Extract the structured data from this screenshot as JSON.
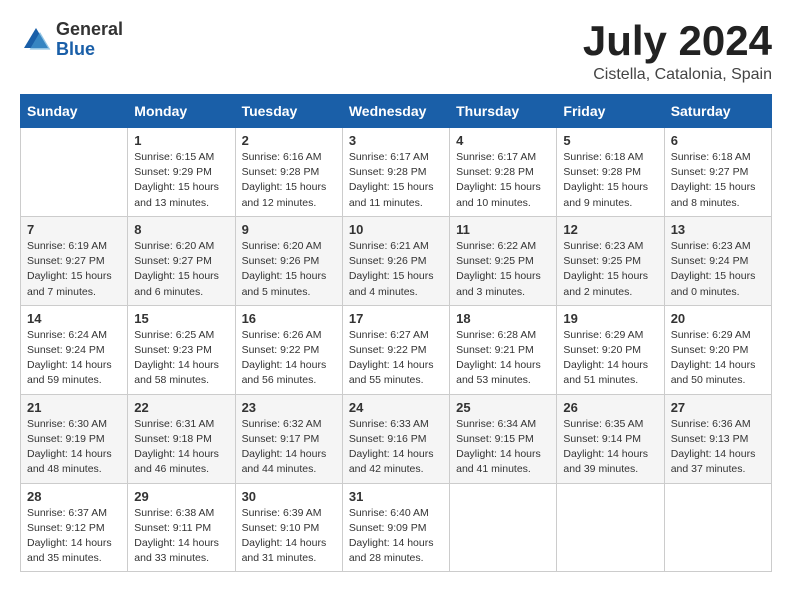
{
  "logo": {
    "general": "General",
    "blue": "Blue"
  },
  "header": {
    "month_year": "July 2024",
    "location": "Cistella, Catalonia, Spain"
  },
  "weekdays": [
    "Sunday",
    "Monday",
    "Tuesday",
    "Wednesday",
    "Thursday",
    "Friday",
    "Saturday"
  ],
  "weeks": [
    [
      {
        "day": "",
        "info": ""
      },
      {
        "day": "1",
        "info": "Sunrise: 6:15 AM\nSunset: 9:29 PM\nDaylight: 15 hours\nand 13 minutes."
      },
      {
        "day": "2",
        "info": "Sunrise: 6:16 AM\nSunset: 9:28 PM\nDaylight: 15 hours\nand 12 minutes."
      },
      {
        "day": "3",
        "info": "Sunrise: 6:17 AM\nSunset: 9:28 PM\nDaylight: 15 hours\nand 11 minutes."
      },
      {
        "day": "4",
        "info": "Sunrise: 6:17 AM\nSunset: 9:28 PM\nDaylight: 15 hours\nand 10 minutes."
      },
      {
        "day": "5",
        "info": "Sunrise: 6:18 AM\nSunset: 9:28 PM\nDaylight: 15 hours\nand 9 minutes."
      },
      {
        "day": "6",
        "info": "Sunrise: 6:18 AM\nSunset: 9:27 PM\nDaylight: 15 hours\nand 8 minutes."
      }
    ],
    [
      {
        "day": "7",
        "info": "Sunrise: 6:19 AM\nSunset: 9:27 PM\nDaylight: 15 hours\nand 7 minutes."
      },
      {
        "day": "8",
        "info": "Sunrise: 6:20 AM\nSunset: 9:27 PM\nDaylight: 15 hours\nand 6 minutes."
      },
      {
        "day": "9",
        "info": "Sunrise: 6:20 AM\nSunset: 9:26 PM\nDaylight: 15 hours\nand 5 minutes."
      },
      {
        "day": "10",
        "info": "Sunrise: 6:21 AM\nSunset: 9:26 PM\nDaylight: 15 hours\nand 4 minutes."
      },
      {
        "day": "11",
        "info": "Sunrise: 6:22 AM\nSunset: 9:25 PM\nDaylight: 15 hours\nand 3 minutes."
      },
      {
        "day": "12",
        "info": "Sunrise: 6:23 AM\nSunset: 9:25 PM\nDaylight: 15 hours\nand 2 minutes."
      },
      {
        "day": "13",
        "info": "Sunrise: 6:23 AM\nSunset: 9:24 PM\nDaylight: 15 hours\nand 0 minutes."
      }
    ],
    [
      {
        "day": "14",
        "info": "Sunrise: 6:24 AM\nSunset: 9:24 PM\nDaylight: 14 hours\nand 59 minutes."
      },
      {
        "day": "15",
        "info": "Sunrise: 6:25 AM\nSunset: 9:23 PM\nDaylight: 14 hours\nand 58 minutes."
      },
      {
        "day": "16",
        "info": "Sunrise: 6:26 AM\nSunset: 9:22 PM\nDaylight: 14 hours\nand 56 minutes."
      },
      {
        "day": "17",
        "info": "Sunrise: 6:27 AM\nSunset: 9:22 PM\nDaylight: 14 hours\nand 55 minutes."
      },
      {
        "day": "18",
        "info": "Sunrise: 6:28 AM\nSunset: 9:21 PM\nDaylight: 14 hours\nand 53 minutes."
      },
      {
        "day": "19",
        "info": "Sunrise: 6:29 AM\nSunset: 9:20 PM\nDaylight: 14 hours\nand 51 minutes."
      },
      {
        "day": "20",
        "info": "Sunrise: 6:29 AM\nSunset: 9:20 PM\nDaylight: 14 hours\nand 50 minutes."
      }
    ],
    [
      {
        "day": "21",
        "info": "Sunrise: 6:30 AM\nSunset: 9:19 PM\nDaylight: 14 hours\nand 48 minutes."
      },
      {
        "day": "22",
        "info": "Sunrise: 6:31 AM\nSunset: 9:18 PM\nDaylight: 14 hours\nand 46 minutes."
      },
      {
        "day": "23",
        "info": "Sunrise: 6:32 AM\nSunset: 9:17 PM\nDaylight: 14 hours\nand 44 minutes."
      },
      {
        "day": "24",
        "info": "Sunrise: 6:33 AM\nSunset: 9:16 PM\nDaylight: 14 hours\nand 42 minutes."
      },
      {
        "day": "25",
        "info": "Sunrise: 6:34 AM\nSunset: 9:15 PM\nDaylight: 14 hours\nand 41 minutes."
      },
      {
        "day": "26",
        "info": "Sunrise: 6:35 AM\nSunset: 9:14 PM\nDaylight: 14 hours\nand 39 minutes."
      },
      {
        "day": "27",
        "info": "Sunrise: 6:36 AM\nSunset: 9:13 PM\nDaylight: 14 hours\nand 37 minutes."
      }
    ],
    [
      {
        "day": "28",
        "info": "Sunrise: 6:37 AM\nSunset: 9:12 PM\nDaylight: 14 hours\nand 35 minutes."
      },
      {
        "day": "29",
        "info": "Sunrise: 6:38 AM\nSunset: 9:11 PM\nDaylight: 14 hours\nand 33 minutes."
      },
      {
        "day": "30",
        "info": "Sunrise: 6:39 AM\nSunset: 9:10 PM\nDaylight: 14 hours\nand 31 minutes."
      },
      {
        "day": "31",
        "info": "Sunrise: 6:40 AM\nSunset: 9:09 PM\nDaylight: 14 hours\nand 28 minutes."
      },
      {
        "day": "",
        "info": ""
      },
      {
        "day": "",
        "info": ""
      },
      {
        "day": "",
        "info": ""
      }
    ]
  ]
}
